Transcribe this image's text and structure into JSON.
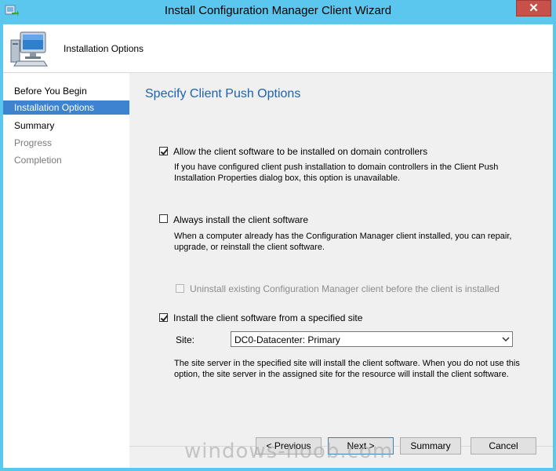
{
  "window": {
    "title": "Install Configuration Manager Client Wizard",
    "close_label": "✕"
  },
  "header": {
    "title": "Installation Options"
  },
  "nav": {
    "items": [
      {
        "label": "Before You Begin",
        "state": "normal"
      },
      {
        "label": "Installation Options",
        "state": "selected"
      },
      {
        "label": "Summary",
        "state": "normal"
      },
      {
        "label": "Progress",
        "state": "disabled"
      },
      {
        "label": "Completion",
        "state": "disabled"
      }
    ]
  },
  "page": {
    "heading": "Specify Client Push Options",
    "options": {
      "domain_controllers": {
        "label": "Allow the client software to be installed on domain controllers",
        "checked": true,
        "desc_line1": "If you have configured client push installation to domain controllers in the Client Push",
        "desc_line2": "Installation Properties dialog box, this option is unavailable."
      },
      "always_install": {
        "label": "Always install the client software",
        "checked": false,
        "desc_line1": "When a computer already has the Configuration Manager client installed, you can repair,",
        "desc_line2": "upgrade, or reinstall the client software."
      },
      "uninstall_existing": {
        "label": "Uninstall existing Configuration Manager client before the client is installed",
        "checked": false,
        "enabled": false
      },
      "specified_site": {
        "label": "Install the client software from a specified site",
        "checked": true,
        "site_label": "Site:",
        "site_value": "DC0-Datacenter: Primary",
        "desc_line1": "The site server in the specified site will install the client software.  When you do not use this",
        "desc_line2": "option, the site server in the assigned site for the resource will install the client software."
      }
    }
  },
  "buttons": {
    "previous": "< Previous",
    "next": "Next >",
    "summary": "Summary",
    "cancel": "Cancel"
  },
  "watermark": "windows-noob.com",
  "icons": {
    "app": "wizard-app-icon",
    "header": "computer-monitor-icon",
    "dropdown": "chevron-down-icon"
  }
}
